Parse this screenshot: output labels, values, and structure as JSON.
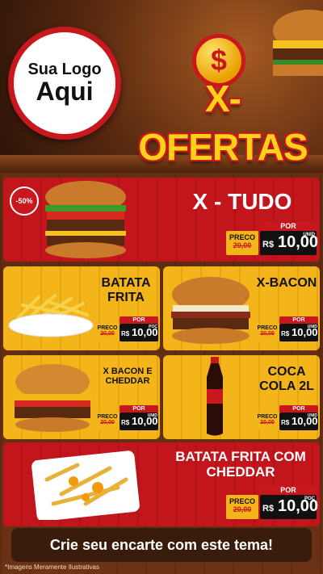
{
  "logo": {
    "line1": "Sua Logo",
    "line2": "Aqui"
  },
  "banner": {
    "coin_symbol": "$",
    "title": "X-OFERTAS"
  },
  "items": [
    {
      "name": "X - TUDO",
      "discount": "-50%",
      "preco_label": "PRECO",
      "old_price": "20,00",
      "por_label": "POR",
      "currency": "R$",
      "price": "10,00",
      "unit": "UNID"
    },
    {
      "name": "BATATA FRITA",
      "preco_label": "PRECO",
      "old_price": "20,00",
      "por_label": "POR",
      "currency": "R$",
      "price": "10,00",
      "unit": "POÇ"
    },
    {
      "name": "X-BACON",
      "preco_label": "PRECO",
      "old_price": "20,00",
      "por_label": "POR",
      "currency": "R$",
      "price": "10,00",
      "unit": "UNID"
    },
    {
      "name": "X BACON E CHEDDAR",
      "preco_label": "PRECO",
      "old_price": "20,00",
      "por_label": "POR",
      "currency": "R$",
      "price": "10,00",
      "unit": "UNID"
    },
    {
      "name": "COCA COLA 2L",
      "preco_label": "PRECO",
      "old_price": "20,00",
      "por_label": "POR",
      "currency": "R$",
      "price": "10,00",
      "unit": "UNID"
    },
    {
      "name": "BATATA FRITA COM CHEDDAR",
      "preco_label": "PRECO",
      "old_price": "20,00",
      "por_label": "POR",
      "currency": "R$",
      "price": "10,00",
      "unit": "POÇ"
    }
  ],
  "footer": {
    "cta": "Crie seu encarte com este tema!",
    "disclaimer": "*Imagens Meramente Ilustrativas"
  }
}
